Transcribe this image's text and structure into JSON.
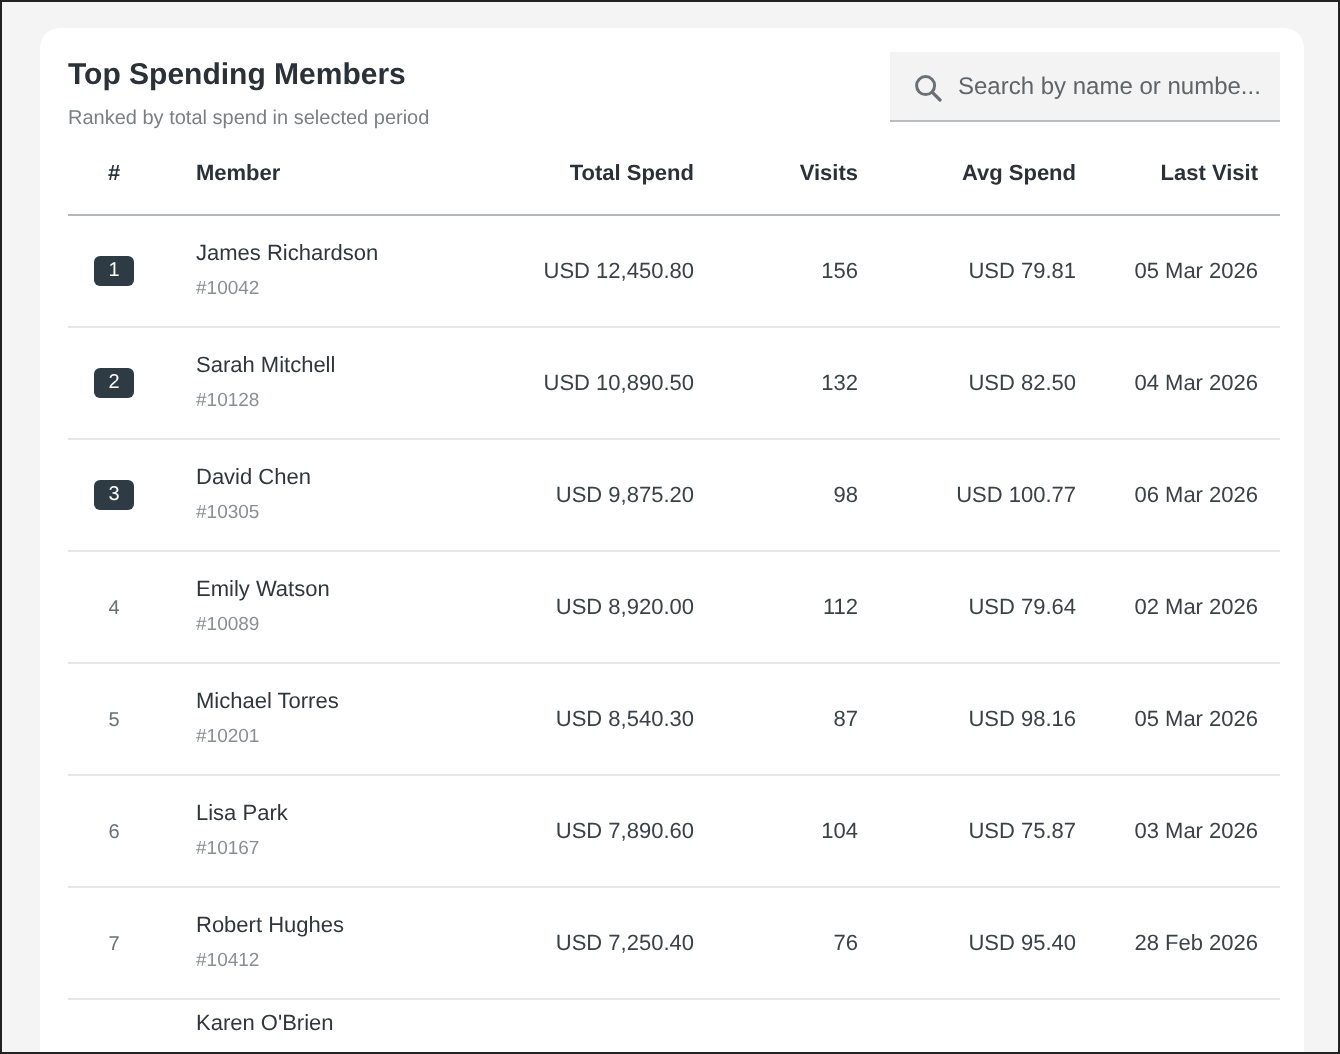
{
  "card": {
    "title": "Top Spending Members",
    "subtitle": "Ranked by total spend in selected period"
  },
  "search": {
    "placeholder": "Search by name or numbe..."
  },
  "table": {
    "columns": [
      "#",
      "Member",
      "Total Spend",
      "Visits",
      "Avg Spend",
      "Last Visit"
    ],
    "rows": [
      {
        "rank": "1",
        "kind": "badge",
        "name": "James Richardson",
        "number": "#10042",
        "total": "USD 12,450.80",
        "visits": "156",
        "avg": "USD 79.81",
        "last": "05 Mar 2026"
      },
      {
        "rank": "2",
        "kind": "badge",
        "name": "Sarah Mitchell",
        "number": "#10128",
        "total": "USD 10,890.50",
        "visits": "132",
        "avg": "USD 82.50",
        "last": "04 Mar 2026"
      },
      {
        "rank": "3",
        "kind": "badge",
        "name": "David Chen",
        "number": "#10305",
        "total": "USD 9,875.20",
        "visits": "98",
        "avg": "USD 100.77",
        "last": "06 Mar 2026"
      },
      {
        "rank": "4",
        "kind": "plain",
        "name": "Emily Watson",
        "number": "#10089",
        "total": "USD 8,920.00",
        "visits": "112",
        "avg": "USD 79.64",
        "last": "02 Mar 2026"
      },
      {
        "rank": "5",
        "kind": "plain",
        "name": "Michael Torres",
        "number": "#10201",
        "total": "USD 8,540.30",
        "visits": "87",
        "avg": "USD 98.16",
        "last": "05 Mar 2026"
      },
      {
        "rank": "6",
        "kind": "plain",
        "name": "Lisa Park",
        "number": "#10167",
        "total": "USD 7,890.60",
        "visits": "104",
        "avg": "USD 75.87",
        "last": "03 Mar 2026"
      },
      {
        "rank": "7",
        "kind": "plain",
        "name": "Robert Hughes",
        "number": "#10412",
        "total": "USD 7,250.40",
        "visits": "76",
        "avg": "USD 95.40",
        "last": "28 Feb 2026"
      },
      {
        "name": "Karen O'Brien"
      }
    ]
  }
}
